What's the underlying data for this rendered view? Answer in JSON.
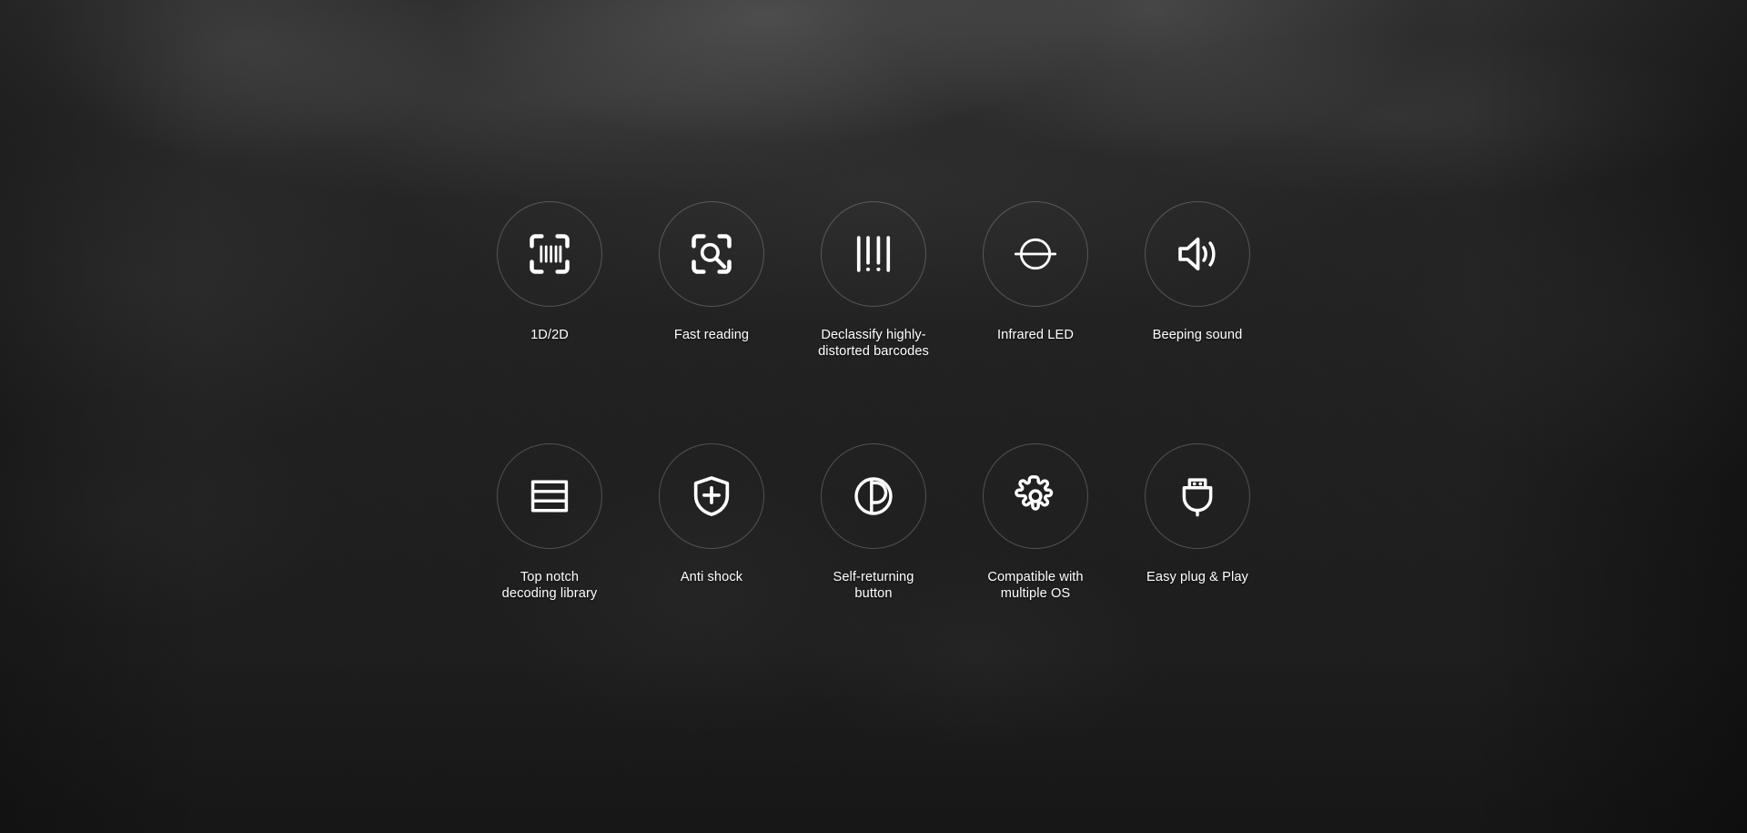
{
  "page": {
    "background_color": "#222222",
    "text_color": "#ffffff",
    "circle_stroke_color": "rgba(255,255,255,0.22)"
  },
  "features": {
    "rows": [
      {
        "items": [
          {
            "icon": "barcode-scan-icon",
            "label": "1D/2D"
          },
          {
            "icon": "scan-search-icon",
            "label": "Fast reading"
          },
          {
            "icon": "distorted-barcode-icon",
            "label": "Declassify highly-\ndistorted barcodes"
          },
          {
            "icon": "infrared-led-icon",
            "label": "Infrared LED"
          },
          {
            "icon": "speaker-sound-icon",
            "label": "Beeping sound"
          }
        ]
      },
      {
        "items": [
          {
            "icon": "decoding-library-icon",
            "label": "Top notch\ndecoding library"
          },
          {
            "icon": "shield-plus-icon",
            "label": "Anti shock"
          },
          {
            "icon": "self-returning-button-icon",
            "label": "Self-returning\nbutton"
          },
          {
            "icon": "gear-icon",
            "label": "Compatible with\nmultiple OS"
          },
          {
            "icon": "usb-plug-icon",
            "label": "Easy plug & Play"
          }
        ]
      }
    ]
  }
}
